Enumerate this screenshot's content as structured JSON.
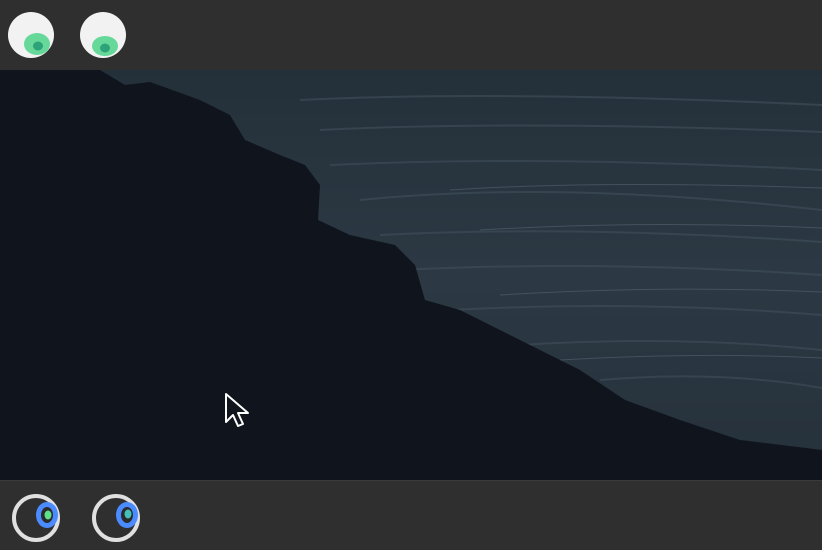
{
  "toolbar_top": {
    "buttons": [
      {
        "name": "eye-toggle-1",
        "icon": "eye-icon"
      },
      {
        "name": "eye-toggle-2",
        "icon": "eye-icon"
      }
    ]
  },
  "toolbar_bottom": {
    "buttons": [
      {
        "name": "lens-toggle-1",
        "icon": "lens-icon"
      },
      {
        "name": "lens-toggle-2",
        "icon": "lens-icon"
      }
    ]
  },
  "viewport": {
    "content": "night-coast-photo"
  },
  "colors": {
    "toolbar_bg": "#2f2f2f",
    "eye_white": "#f2f2f2",
    "eye_iris": "#66d99a",
    "eye_pupil": "#2ea37a",
    "lens_ring": "#e0e0e0",
    "lens_blue": "#4a8cff",
    "lens_green": "#5fe08a",
    "cliff": "#10141c",
    "sea": "#2a3540"
  }
}
